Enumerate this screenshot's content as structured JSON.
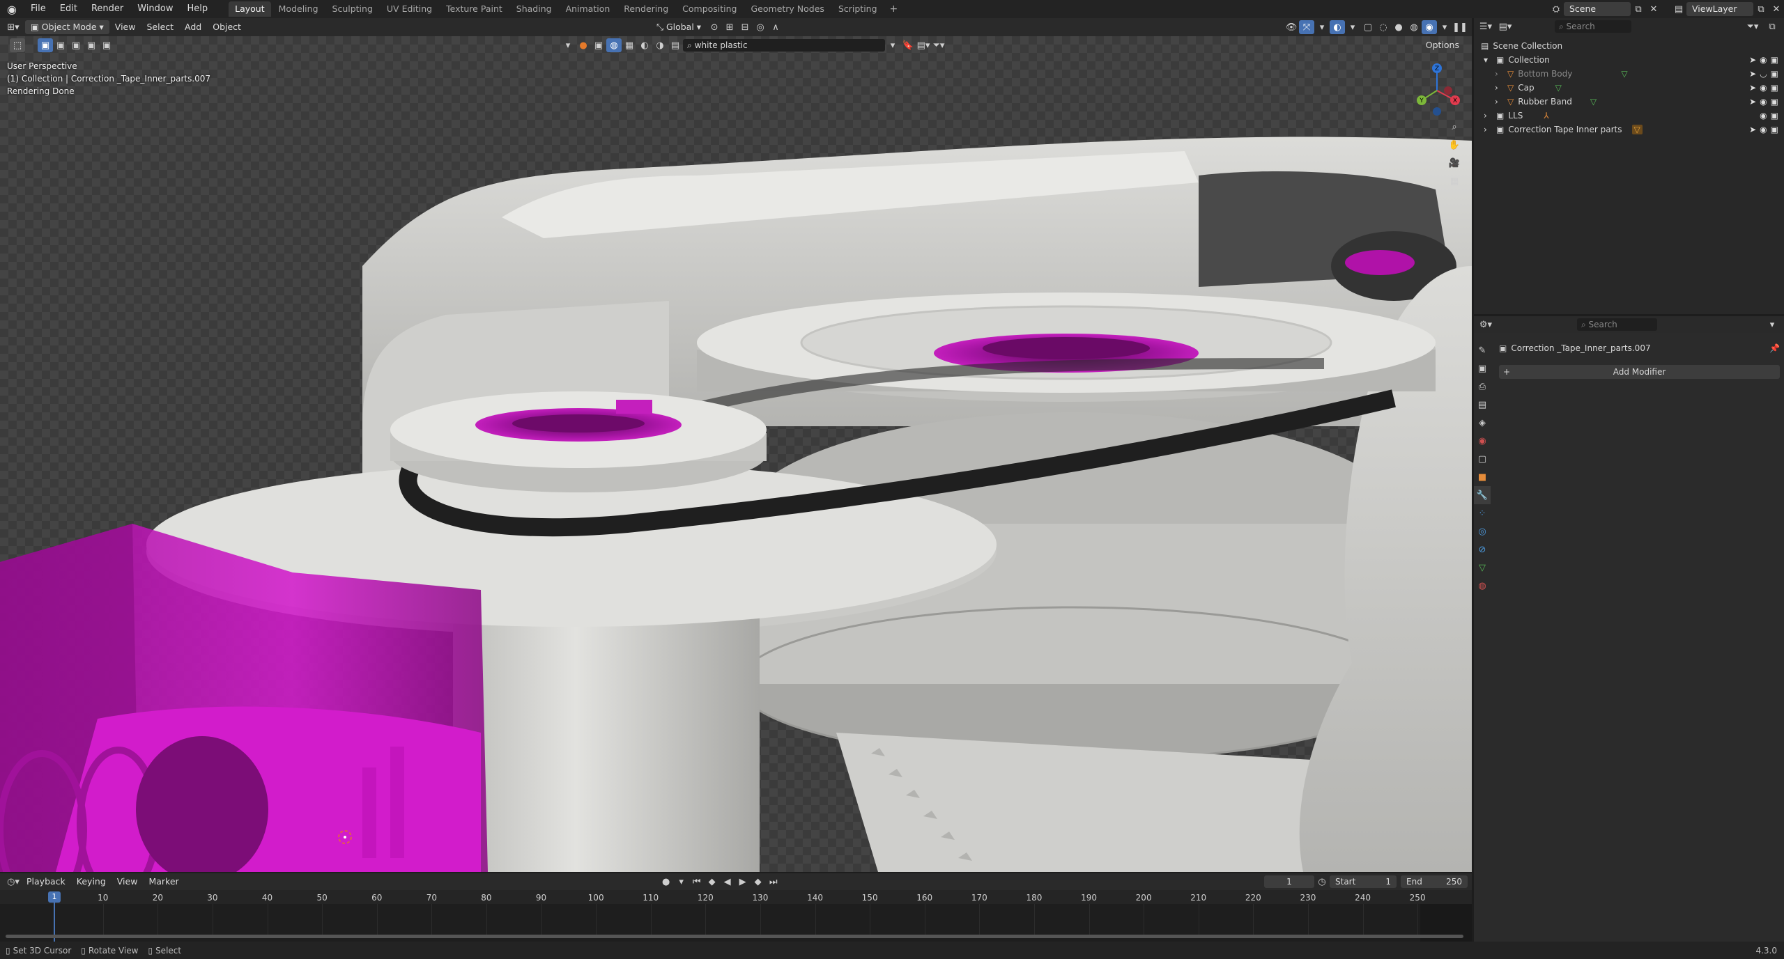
{
  "topbar": {
    "menus": [
      "File",
      "Edit",
      "Render",
      "Window",
      "Help"
    ],
    "workspaces": [
      "Layout",
      "Modeling",
      "Sculpting",
      "UV Editing",
      "Texture Paint",
      "Shading",
      "Animation",
      "Rendering",
      "Compositing",
      "Geometry Nodes",
      "Scripting"
    ],
    "active_workspace": "Layout",
    "add_tab": "+",
    "scene": "Scene",
    "view_layer": "ViewLayer"
  },
  "viewport_header": {
    "mode": "Object Mode",
    "menus": [
      "View",
      "Select",
      "Add",
      "Object"
    ],
    "orientation": "Global",
    "material_search": "white plastic",
    "options": "Options"
  },
  "overlay": {
    "line1": "User Perspective",
    "line2": "(1) Collection | Correction _Tape_Inner_parts.007",
    "line3": "Rendering Done"
  },
  "gizmo": {
    "x": "X",
    "y": "Y",
    "z": "Z"
  },
  "outliner": {
    "search_placeholder": "Search",
    "root": "Scene Collection",
    "items": [
      {
        "label": "Collection",
        "level": 0
      },
      {
        "label": "Bottom Body",
        "level": 1
      },
      {
        "label": "Cap",
        "level": 1
      },
      {
        "label": "Rubber Band",
        "level": 1
      },
      {
        "label": "LLS",
        "level": 0
      },
      {
        "label": "Correction Tape Inner parts",
        "level": 0
      }
    ]
  },
  "properties": {
    "search_placeholder": "Search",
    "object_name": "Correction _Tape_Inner_parts.007",
    "add_modifier": "Add Modifier"
  },
  "timeline_header": {
    "menus": [
      "Playback",
      "Keying",
      "View",
      "Marker"
    ],
    "current_frame": "1",
    "start_label": "Start",
    "start_value": "1",
    "end_label": "End",
    "end_value": "250"
  },
  "timeline": {
    "current": "1",
    "ticks": [
      "10",
      "20",
      "30",
      "40",
      "50",
      "60",
      "70",
      "80",
      "90",
      "100",
      "110",
      "120",
      "130",
      "140",
      "150",
      "160",
      "170",
      "180",
      "190",
      "200",
      "210",
      "220",
      "230",
      "240",
      "250"
    ]
  },
  "status": {
    "items": [
      "Set 3D Cursor",
      "Rotate View",
      "Select"
    ],
    "version": "4.3.0"
  },
  "colors": {
    "accent": "#4772b3",
    "selection_magenta": "#c012b8",
    "plastic_white": "#d2d2cf"
  }
}
